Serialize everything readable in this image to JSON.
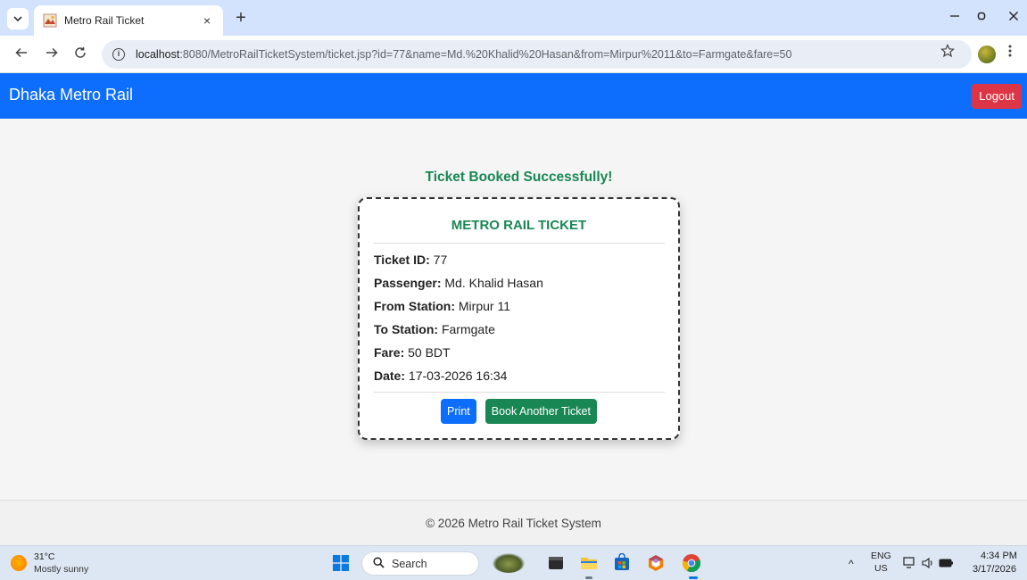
{
  "browser": {
    "tab_title": "Metro Rail Ticket",
    "tab_close": "×",
    "new_tab": "+",
    "url_host": "localhost",
    "url_rest": ":8080/MetroRailTicketSystem/ticket.jsp?id=77&name=Md.%20Khalid%20Hasan&from=Mirpur%2011&to=Farmgate&fare=50",
    "icons": [
      "chevron-down-icon",
      "favicon",
      "back-icon",
      "forward-icon",
      "reload-icon",
      "info-icon",
      "star-icon",
      "profile-icon",
      "more-icon",
      "minimize-icon",
      "restore-icon",
      "close-icon"
    ]
  },
  "navbar": {
    "brand": "Dhaka Metro Rail",
    "logout": "Logout",
    "color": "#0d6efd"
  },
  "main": {
    "success_message": "Ticket Booked Successfully!",
    "ticket": {
      "heading": "METRO RAIL TICKET",
      "rows": [
        {
          "label": "Ticket ID:",
          "value": "77"
        },
        {
          "label": "Passenger:",
          "value": "Md. Khalid Hasan"
        },
        {
          "label": "From Station:",
          "value": "Mirpur 11"
        },
        {
          "label": "To Station:",
          "value": "Farmgate"
        },
        {
          "label": "Fare:",
          "value": "50 BDT"
        },
        {
          "label": "Date:",
          "value": "17-03-2026 16:34"
        }
      ],
      "print_label": "Print",
      "book_another_label": "Book Another Ticket"
    }
  },
  "footer": {
    "text": "© 2026 Metro Rail Ticket System"
  },
  "taskbar": {
    "weather_temp": "31°C",
    "weather_desc": "Mostly sunny",
    "search_label": "Search",
    "tray_chevron": "^",
    "language": "ENG",
    "region": "US",
    "time": "4:34 PM",
    "date": "3/17/2026"
  },
  "colors": {
    "success": "#198754",
    "danger": "#dc3545",
    "primary": "#0d6efd"
  }
}
